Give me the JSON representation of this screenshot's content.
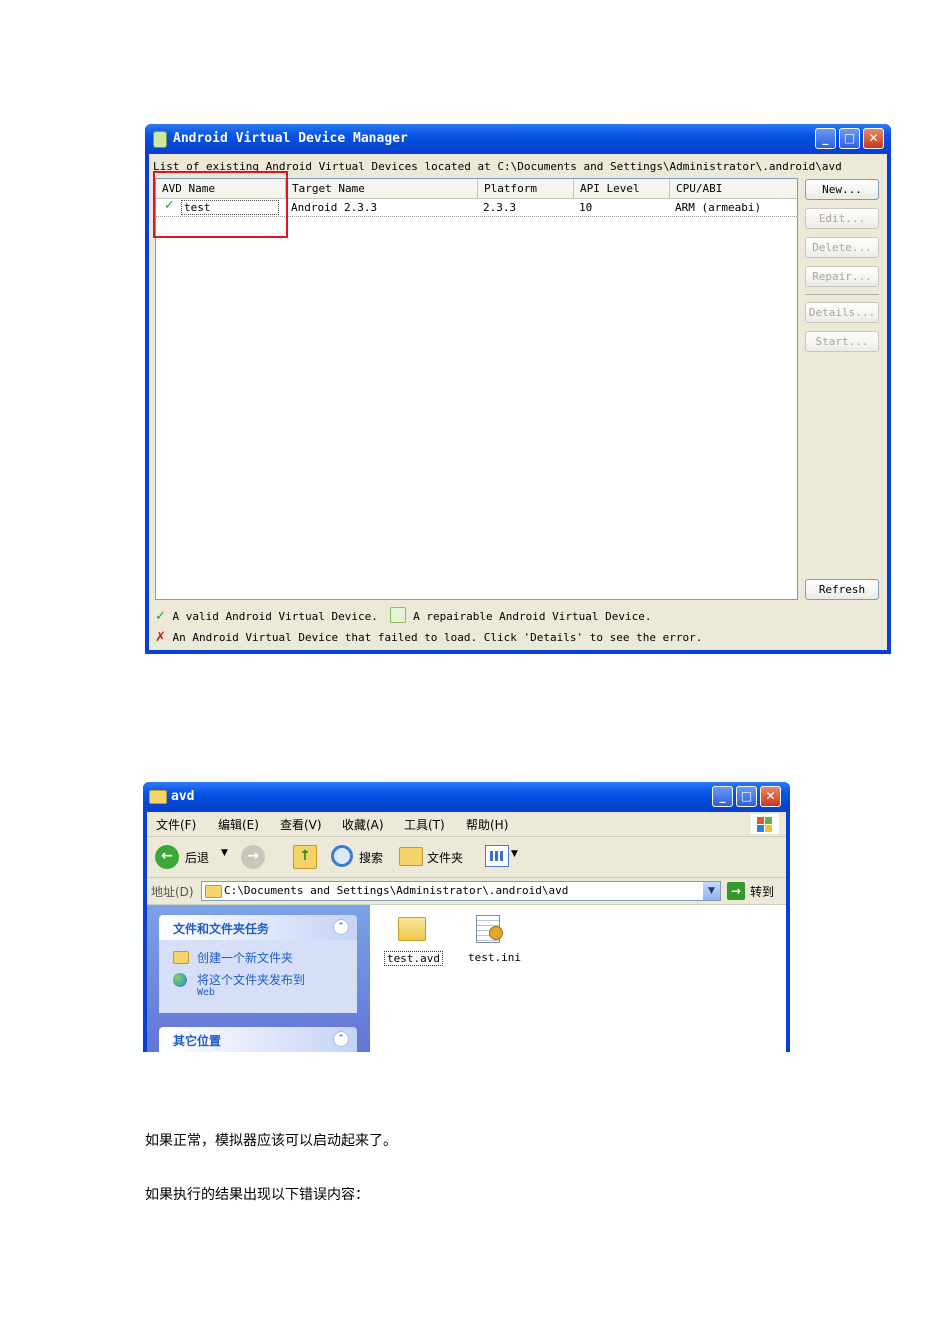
{
  "avd_manager": {
    "title": "Android Virtual Device Manager",
    "path_label": "List of existing Android Virtual Devices located at C:\\Documents and Settings\\Administrator\\.android\\avd",
    "columns": [
      "AVD Name",
      "Target Name",
      "Platform",
      "API Level",
      "CPU/ABI"
    ],
    "rows": [
      {
        "status": "valid",
        "name": "test",
        "target": "Android 2.3.3",
        "platform": "2.3.3",
        "api": "10",
        "abi": "ARM (armeabi)"
      }
    ],
    "buttons": {
      "new": "New...",
      "edit": "Edit...",
      "delete": "Delete...",
      "repair": "Repair...",
      "details": "Details...",
      "start": "Start...",
      "refresh": "Refresh"
    },
    "legend": {
      "valid": "A valid Android Virtual Device.",
      "repairable": "A repairable Android Virtual Device.",
      "failed": "An Android Virtual Device that failed to load. Click 'Details' to see the error."
    },
    "highlight_color": "#e0141e"
  },
  "explorer": {
    "title": "avd",
    "menu": [
      "文件(F)",
      "编辑(E)",
      "查看(V)",
      "收藏(A)",
      "工具(T)",
      "帮助(H)"
    ],
    "toolbar": {
      "back": "后退",
      "search": "搜索",
      "folders": "文件夹"
    },
    "address_label": "地址(D)",
    "address_value": "C:\\Documents and Settings\\Administrator\\.android\\avd",
    "go_label": "转到",
    "tasks_panel": {
      "title": "文件和文件夹任务",
      "items": [
        "创建一个新文件夹",
        "将这个文件夹发布到"
      ],
      "web": "Web"
    },
    "other_panel": {
      "title": "其它位置"
    },
    "files": [
      "test.avd",
      "test.ini"
    ]
  },
  "text": {
    "para1": "如果正常，模拟器应该可以启动起来了。",
    "para2": "如果执行的结果出现以下错误内容："
  }
}
